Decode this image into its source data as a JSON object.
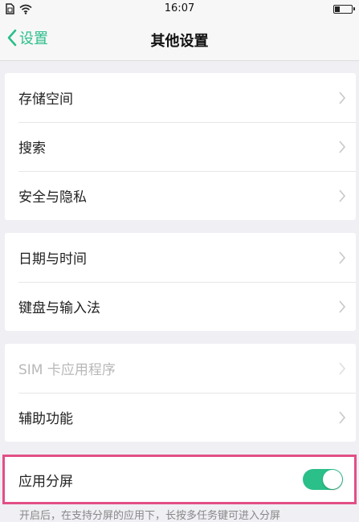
{
  "status_bar": {
    "time": "16:07",
    "icons": [
      "sim-icon",
      "wifi-icon",
      "battery-icon"
    ]
  },
  "nav": {
    "back_label": "设置",
    "title": "其他设置"
  },
  "groups": [
    {
      "items": [
        {
          "label": "存储空间",
          "enabled": true
        },
        {
          "label": "搜索",
          "enabled": true
        },
        {
          "label": "安全与隐私",
          "enabled": true
        }
      ]
    },
    {
      "items": [
        {
          "label": "日期与时间",
          "enabled": true
        },
        {
          "label": "键盘与输入法",
          "enabled": true
        }
      ]
    },
    {
      "items": [
        {
          "label": "SIM 卡应用程序",
          "enabled": false
        },
        {
          "label": "辅助功能",
          "enabled": true
        }
      ]
    }
  ],
  "split_screen": {
    "label": "应用分屏",
    "enabled": true
  },
  "footnote": "开启后，在支持分屏的应用下，长按多任务键可进入分屏",
  "colors": {
    "accent": "#2bbf8a",
    "highlight": "#e24f86",
    "background": "#efeff4"
  }
}
